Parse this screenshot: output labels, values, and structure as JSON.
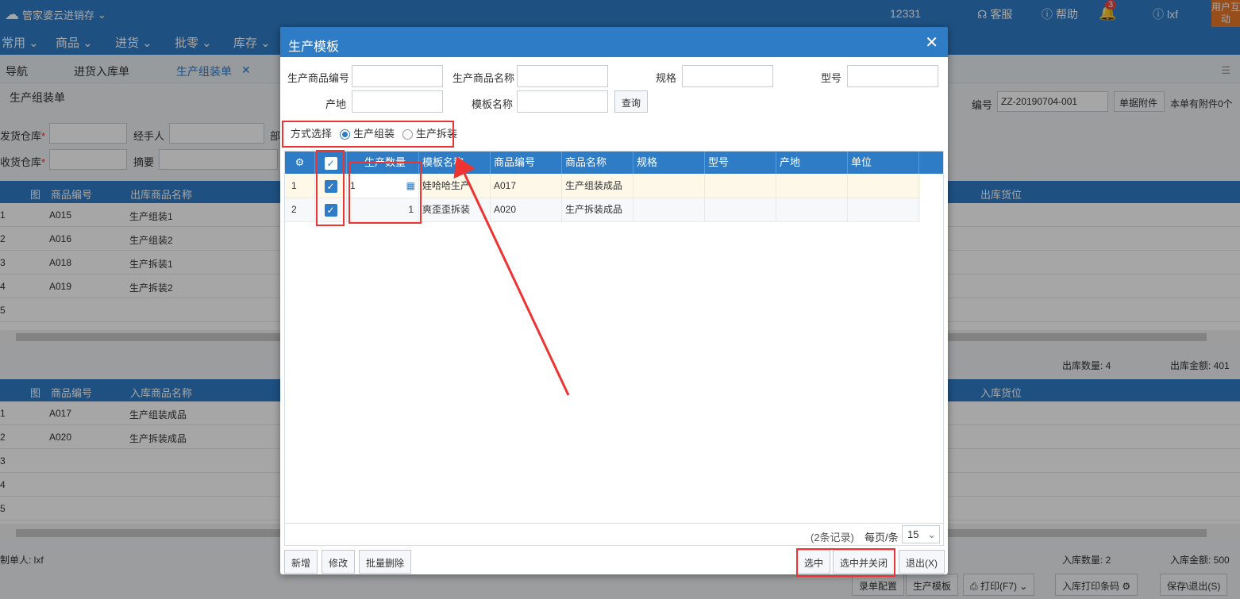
{
  "app": {
    "logo": "管家婆云进销存",
    "phone": "12331",
    "service": "客服",
    "help": "帮助",
    "notifications": "3",
    "user": "lxf",
    "user_tag": "用户互动"
  },
  "menu": [
    "常用",
    "商品",
    "进货",
    "批零",
    "库存"
  ],
  "tabs": {
    "nav": "导航",
    "purchase": "进货入库单",
    "assembly": "生产组装单"
  },
  "bg": {
    "title": "生产组装单",
    "ship_wh": "发货仓库",
    "recv_wh": "收货仓库",
    "handler": "经手人",
    "dept": "部",
    "summary": "摘要",
    "doc_no_label": "编号",
    "doc_no": "ZZ-20190704-001",
    "attach_btn": "单据附件",
    "attach_info": "本单有附件0个",
    "grid1": {
      "headers": [
        "图",
        "商品编号",
        "出库商品名称",
        "出库货位"
      ],
      "rows": [
        {
          "no": "1",
          "code": "A015",
          "name": "生产组装1"
        },
        {
          "no": "2",
          "code": "A016",
          "name": "生产组装2"
        },
        {
          "no": "3",
          "code": "A018",
          "name": "生产拆装1"
        },
        {
          "no": "4",
          "code": "A019",
          "name": "生产拆装2"
        },
        {
          "no": "5",
          "code": "",
          "name": ""
        }
      ]
    },
    "out_qty": "出库数量: 4",
    "out_amt": "出库金额: 401",
    "grid2": {
      "headers": [
        "图",
        "商品编号",
        "入库商品名称",
        "入库货位"
      ],
      "rows": [
        {
          "no": "1",
          "code": "A017",
          "name": "生产组装成品"
        },
        {
          "no": "2",
          "code": "A020",
          "name": "生产拆装成品"
        },
        {
          "no": "3",
          "code": "",
          "name": ""
        },
        {
          "no": "4",
          "code": "",
          "name": ""
        },
        {
          "no": "5",
          "code": "",
          "name": ""
        }
      ]
    },
    "creator": "制单人: lxf",
    "in_qty": "入库数量: 2",
    "in_amt": "入库金额: 500",
    "bottom_btns": [
      "录单配置",
      "生产模板",
      "打印(F7)",
      "入库打印条码",
      "保存\\退出(S)"
    ]
  },
  "modal": {
    "title": "生产模板",
    "filters": {
      "code": "生产商品编号",
      "name": "生产商品名称",
      "spec": "规格",
      "model": "型号",
      "origin": "产地",
      "template": "模板名称",
      "query": "查询"
    },
    "mode_label": "方式选择",
    "mode_options": [
      "生产组装",
      "生产拆装"
    ],
    "mode_selected": "生产组装",
    "columns": [
      "生产数量",
      "模板名称",
      "商品编号",
      "商品名称",
      "规格",
      "型号",
      "产地",
      "单位"
    ],
    "rows": [
      {
        "no": "1",
        "qty": "1",
        "template": "娃哈哈生产",
        "code": "A017",
        "name": "生产组装成品",
        "checked": true
      },
      {
        "no": "2",
        "qty": "1",
        "template": "爽歪歪拆装",
        "code": "A020",
        "name": "生产拆装成品",
        "checked": true
      }
    ],
    "records": "(2条记录)",
    "per_page_label": "每页/条",
    "per_page": "15",
    "buttons": {
      "add": "新增",
      "edit": "修改",
      "batch_delete": "批量删除",
      "select": "选中",
      "select_close": "选中并关闭",
      "exit": "退出(X)"
    }
  }
}
